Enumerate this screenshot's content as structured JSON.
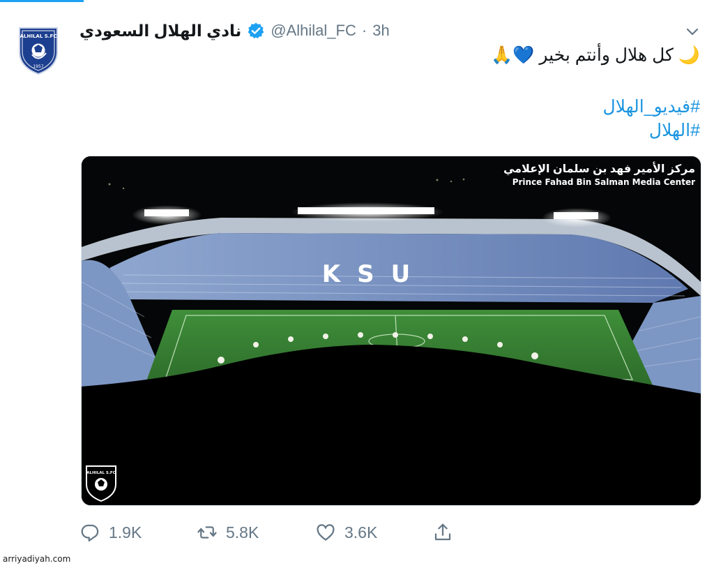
{
  "account": {
    "display_name": "نادي الهلال السعودي",
    "handle": "@Alhilal_FC",
    "separator": "·",
    "time": "3h",
    "verified_icon": "verified-badge-icon",
    "avatar_text": "ALHILAL S.FC",
    "avatar_year": "1957"
  },
  "tweet": {
    "text_line": "كل هلال وأنتم بخير",
    "emoji_moon": "🌙",
    "emoji_heart": "💙",
    "emoji_pray": "🙏",
    "hashtags": [
      "#فيديو_الهلال",
      "#الهلال"
    ]
  },
  "media": {
    "watermark_ar": "مركز الأمير فهد بن سلمان الإعلامي",
    "watermark_en": "Prince Fahad Bin Salman Media Center",
    "stand_letters": "KSU",
    "logo_text": "ALHILAL S.FC"
  },
  "actions": {
    "replies": "1.9K",
    "retweets": "5.8K",
    "likes": "3.6K"
  },
  "source_credit": "arriyadiyah.com",
  "colors": {
    "link": "#1b95e0",
    "secondary": "#657786",
    "club_blue": "#1d3f8f"
  }
}
